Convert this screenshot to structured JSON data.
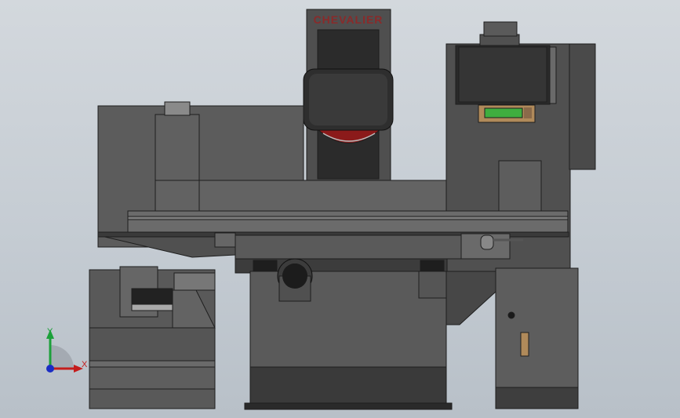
{
  "machine": {
    "brand_label": "CHEVALIER",
    "brand_color": "#8a2a2a",
    "body_color": "#5c5c5c",
    "wheel_color": "#8b1a1a",
    "display_color": "#3fae3f"
  },
  "triad": {
    "x_label": "X",
    "y_label": "Y",
    "x_color": "#c41c1c",
    "y_color": "#1ca03a",
    "z_color": "#1a2cc4"
  }
}
